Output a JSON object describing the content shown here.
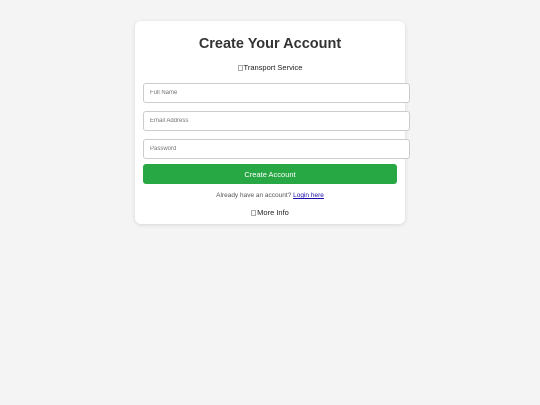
{
  "form": {
    "title": "Create Your Account",
    "top_image_alt": "Transport Service",
    "fields": {
      "full_name_placeholder": "Full Name",
      "email_placeholder": "Email Address",
      "password_placeholder": "Password"
    },
    "submit_label": "Create Account",
    "login_prompt": "Already have an account?",
    "login_link": "Login here",
    "bottom_image_alt": "More Info"
  },
  "colors": {
    "background": "#f4f4f4",
    "card": "#ffffff",
    "button": "#28a745",
    "link": "#1a0dab"
  }
}
